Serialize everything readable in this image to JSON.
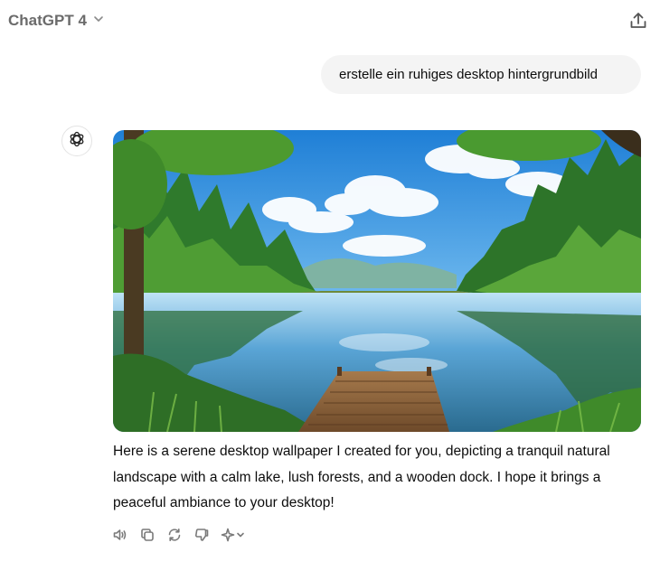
{
  "header": {
    "model_name": "ChatGPT 4",
    "icons": {
      "model_dropdown": "chevron-down-icon",
      "share": "share-icon"
    }
  },
  "conversation": {
    "user_message": "erstelle ein ruhiges desktop hintergrundbild",
    "assistant": {
      "avatar_icon": "openai-logo-icon",
      "image_description_icon": "generated-image",
      "response_text": "Here is a serene desktop wallpaper I created for you, depicting a tranquil natural landscape with a calm lake, lush forests, and a wooden dock. I hope it brings a peaceful ambiance to your desktop!",
      "actions": [
        "read-aloud-icon",
        "copy-icon",
        "regenerate-icon",
        "thumbs-down-icon",
        "sparkle-model-icon"
      ]
    }
  },
  "colors": {
    "text": "#0d0d0d",
    "muted": "#6b6b6b",
    "bubble": "#f4f4f4",
    "icon": "#7a7a7a"
  }
}
